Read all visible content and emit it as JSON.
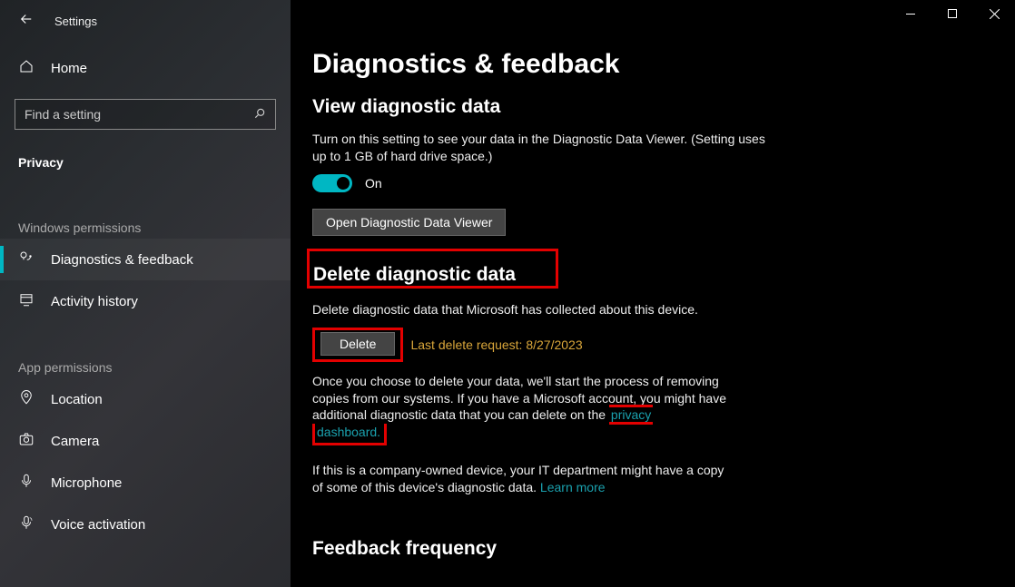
{
  "window": {
    "title": "Settings"
  },
  "sidebar": {
    "home": "Home",
    "search_placeholder": "Find a setting",
    "category": "Privacy",
    "groups": [
      {
        "header": "Windows permissions",
        "items": [
          {
            "icon": "feedback-icon",
            "label": "Diagnostics & feedback",
            "active": true
          },
          {
            "icon": "history-icon",
            "label": "Activity history",
            "active": false
          }
        ]
      },
      {
        "header": "App permissions",
        "items": [
          {
            "icon": "location-icon",
            "label": "Location",
            "active": false
          },
          {
            "icon": "camera-icon",
            "label": "Camera",
            "active": false
          },
          {
            "icon": "microphone-icon",
            "label": "Microphone",
            "active": false
          },
          {
            "icon": "voice-icon",
            "label": "Voice activation",
            "active": false
          }
        ]
      }
    ]
  },
  "page": {
    "title": "Diagnostics & feedback",
    "view_section": {
      "heading": "View diagnostic data",
      "description": "Turn on this setting to see your data in the Diagnostic Data Viewer. (Setting uses up to 1 GB of hard drive space.)",
      "toggle_state": "On",
      "open_viewer_btn": "Open Diagnostic Data Viewer"
    },
    "delete_section": {
      "heading": "Delete diagnostic data",
      "description": "Delete diagnostic data that Microsoft has collected about this device.",
      "delete_btn": "Delete",
      "last_request": "Last delete request: 8/27/2023",
      "para_prefix": "Once you choose to delete your data, we'll start the process of removing copies from our systems. If you have a Microsoft account, you might have additional diagnostic data that you can delete on the ",
      "privacy_link": "privacy dashboard.",
      "company_note_prefix": "If this is a company-owned device, your IT department might have a copy of some of this device's diagnostic data. ",
      "learn_more": "Learn more"
    },
    "feedback_section": {
      "heading": "Feedback frequency"
    }
  }
}
